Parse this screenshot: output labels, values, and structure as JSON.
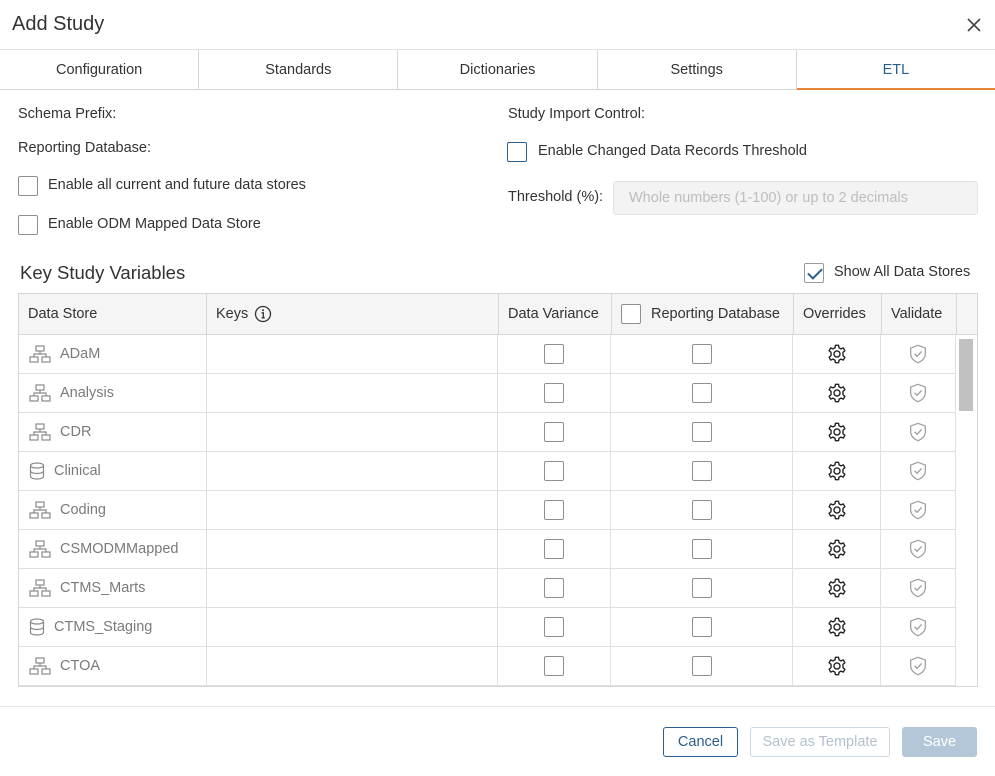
{
  "dialog": {
    "title": "Add Study"
  },
  "tabs": [
    {
      "label": "Configuration",
      "active": false
    },
    {
      "label": "Standards",
      "active": false
    },
    {
      "label": "Dictionaries",
      "active": false
    },
    {
      "label": "Settings",
      "active": false
    },
    {
      "label": "ETL",
      "active": true
    }
  ],
  "form": {
    "schema_prefix_label": "Schema Prefix:",
    "reporting_db_label": "Reporting Database:",
    "enable_all_stores_label": "Enable all current and future data stores",
    "enable_all_stores_checked": false,
    "enable_odm_label": "Enable ODM Mapped Data Store",
    "enable_odm_checked": false,
    "import_control_label": "Study Import Control:",
    "enable_threshold_label": "Enable Changed Data Records Threshold",
    "enable_threshold_checked": false,
    "threshold_label": "Threshold (%):",
    "threshold_value": "",
    "threshold_placeholder": "Whole numbers (1-100) or up to 2 decimals"
  },
  "key_study": {
    "title": "Key Study Variables",
    "show_all_label": "Show All Data Stores",
    "show_all_checked": true,
    "columns": {
      "data_store": "Data Store",
      "keys": "Keys",
      "data_variance": "Data Variance",
      "reporting_db": "Reporting Database",
      "overrides": "Overrides",
      "validate": "Validate"
    },
    "rows": [
      {
        "name": "ADaM",
        "icon": "hierarchy-icon"
      },
      {
        "name": "Analysis",
        "icon": "hierarchy-icon"
      },
      {
        "name": "CDR",
        "icon": "hierarchy-icon"
      },
      {
        "name": "Clinical",
        "icon": "database-icon"
      },
      {
        "name": "Coding",
        "icon": "hierarchy-icon"
      },
      {
        "name": "CSMODMMapped",
        "icon": "hierarchy-icon"
      },
      {
        "name": "CTMS_Marts",
        "icon": "hierarchy-icon"
      },
      {
        "name": "CTMS_Staging",
        "icon": "database-icon"
      },
      {
        "name": "CTOA",
        "icon": "hierarchy-icon"
      },
      {
        "name": "",
        "icon": "hierarchy-icon"
      }
    ]
  },
  "footer": {
    "cancel_label": "Cancel",
    "save_template_label": "Save as Template",
    "save_label": "Save"
  },
  "colors": {
    "accent": "#2a5e8c",
    "active_tab_underline": "#e8833a",
    "disabled_button": "#b4c7d8"
  }
}
